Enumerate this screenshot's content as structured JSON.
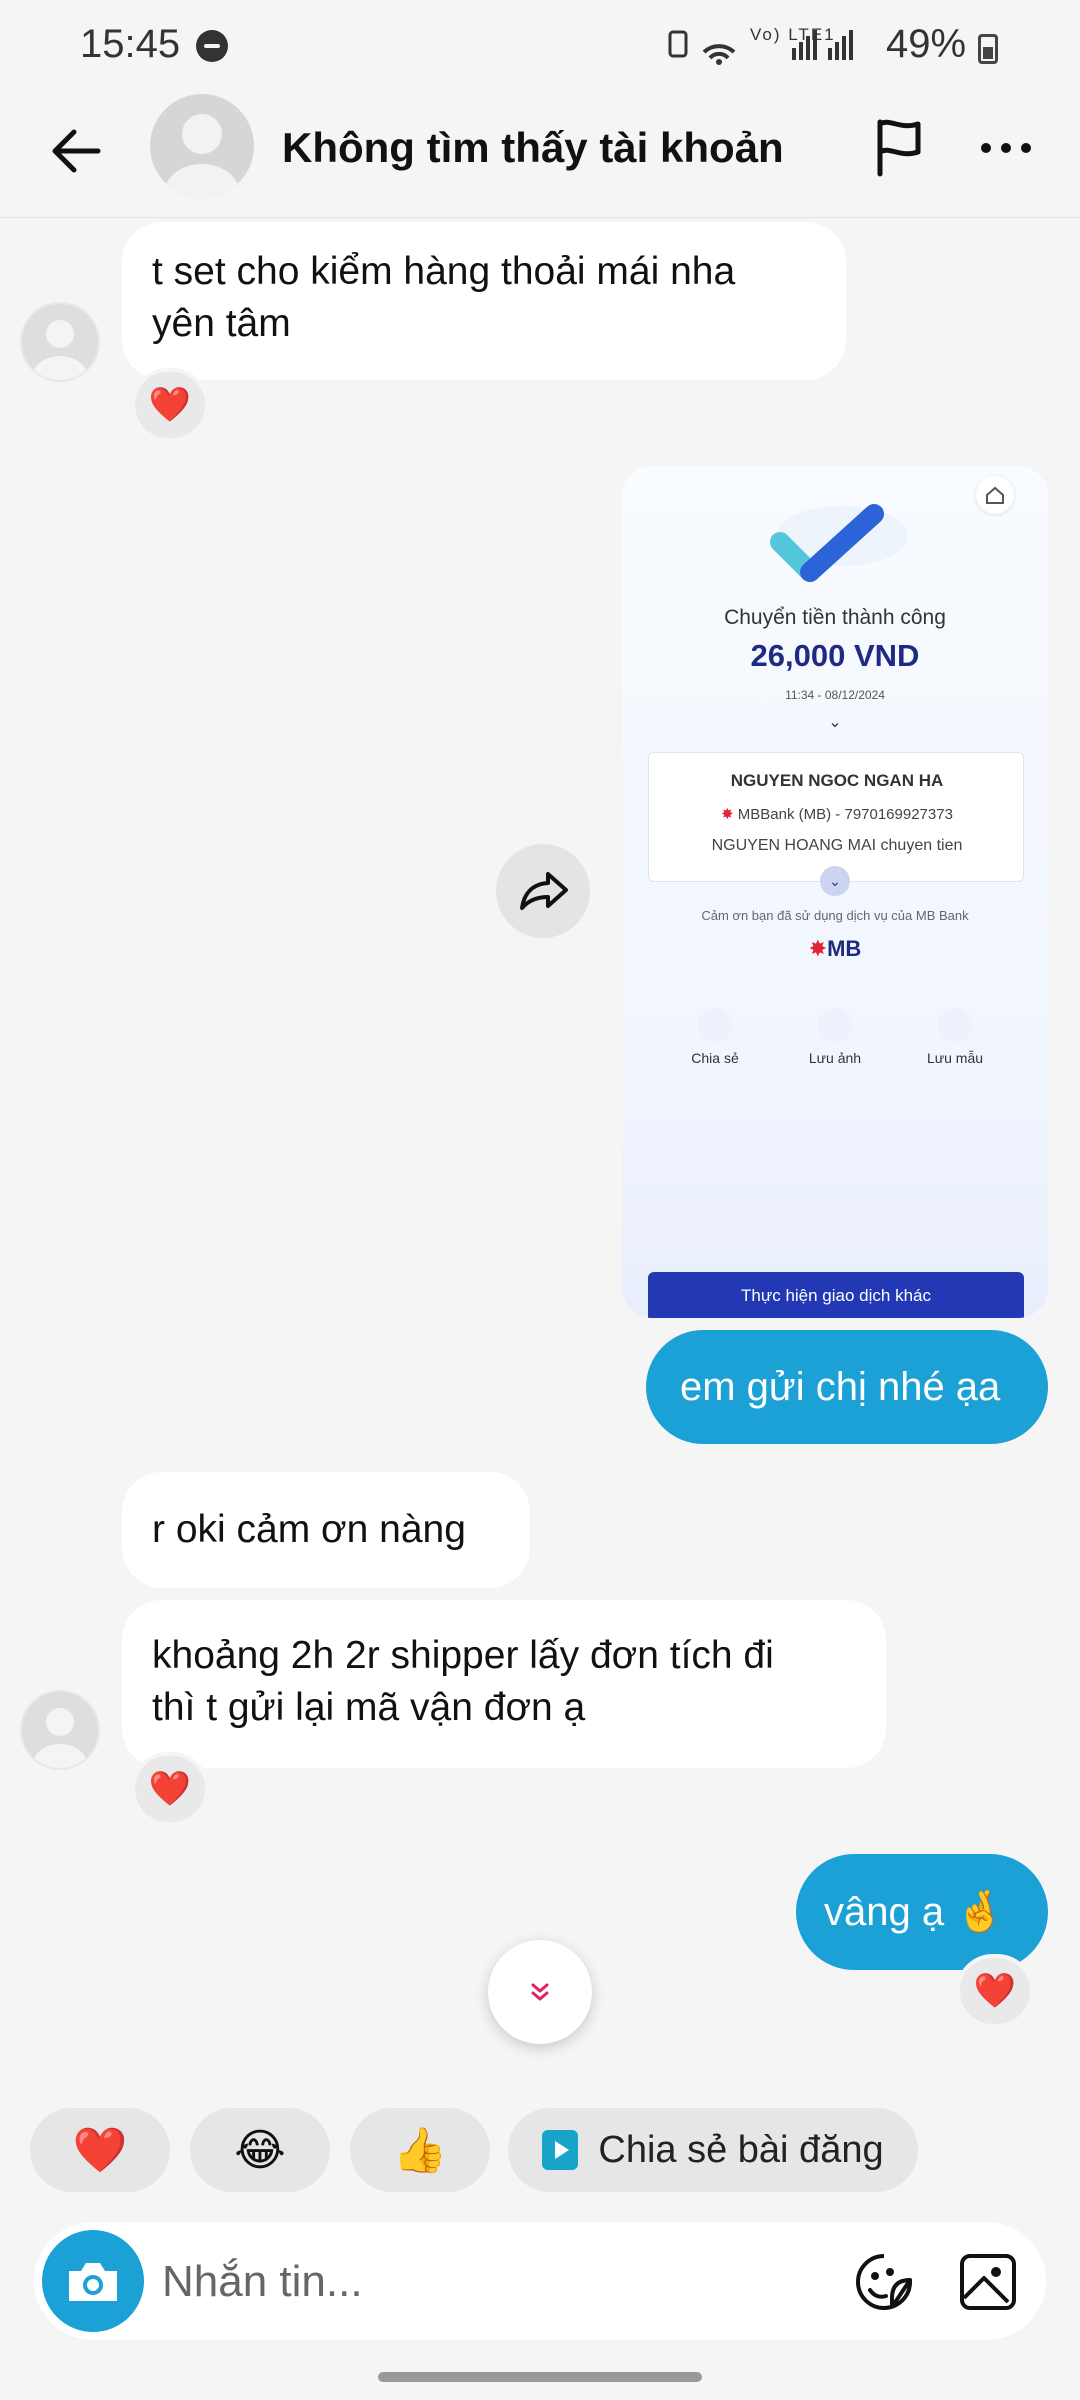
{
  "status_bar": {
    "time": "15:45",
    "network_labels": "Vo) LTE1",
    "battery": "49%"
  },
  "header": {
    "title": "Không tìm thấy tài khoản"
  },
  "messages": [
    {
      "side": "in",
      "text_lines": [
        "t set cho kiểm hàng thoải mái nha",
        "yên tâm"
      ],
      "reaction": "❤️"
    },
    {
      "side": "out",
      "type": "image"
    },
    {
      "side": "out",
      "text": "em gửi chị nhé ạa"
    },
    {
      "side": "in",
      "text": "r oki cảm ơn nàng"
    },
    {
      "side": "in",
      "text_lines": [
        "khoảng 2h 2r shipper lấy đơn tích đi",
        "thì t gửi lại mã vận đơn ạ"
      ],
      "reaction": "❤️"
    },
    {
      "side": "out",
      "text": "vâng ạ 🤞",
      "reaction": "❤️"
    }
  ],
  "payment_receipt": {
    "title": "Chuyển tiền thành công",
    "amount": "26,000 VND",
    "time": "11:34 - 08/12/2024",
    "recipient": "NGUYEN NGOC NGAN HA",
    "bank_account": "MBBank (MB) - 7970169927373",
    "note": "NGUYEN HOANG MAI chuyen tien",
    "thanks": "Cảm ơn bạn đã sử dụng dịch vụ của MB Bank",
    "bank_logo": "MB",
    "actions": [
      "Chia sẻ",
      "Lưu ảnh",
      "Lưu mẫu"
    ],
    "button": "Thực hiện giao dịch khác"
  },
  "quick_reactions": [
    "❤️",
    "😂",
    "👍"
  ],
  "share_post_label": "Chia sẻ bài đăng",
  "composer": {
    "placeholder": "Nhắn tin..."
  },
  "colors": {
    "outgoing_bubble": "#1ba1d6",
    "incoming_bubble": "#ffffff",
    "background": "#f5f5f5",
    "heart": "#ff3b6b"
  }
}
